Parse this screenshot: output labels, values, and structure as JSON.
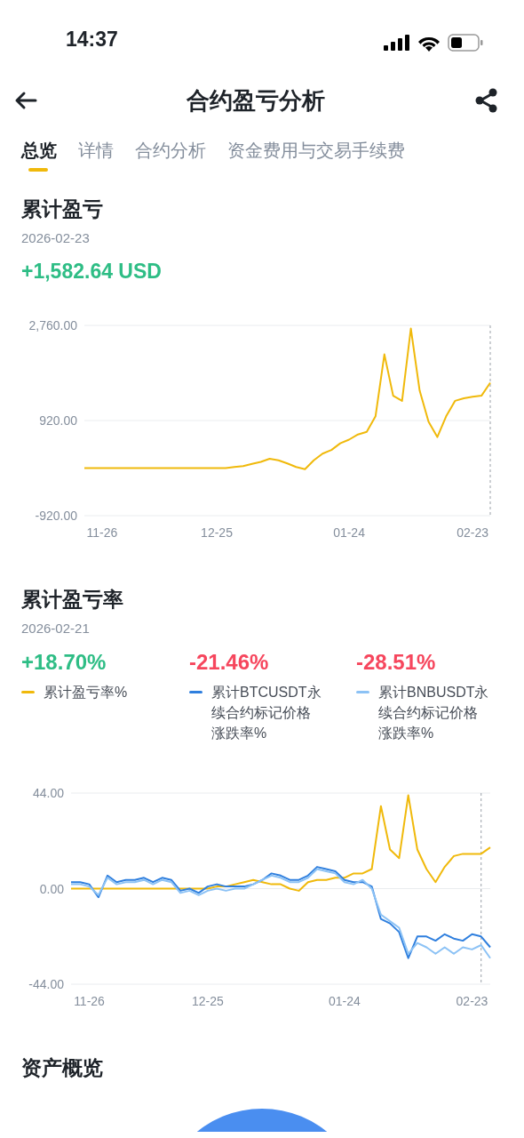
{
  "status_bar": {
    "time": "14:37"
  },
  "header": {
    "title": "合约盈亏分析"
  },
  "tabs": [
    {
      "label": "总览",
      "selected": true
    },
    {
      "label": "详情",
      "selected": false
    },
    {
      "label": "合约分析",
      "selected": false
    },
    {
      "label": "资金费用与交易手续费",
      "selected": false
    }
  ],
  "pnl_section": {
    "title": "累计盈亏",
    "date": "2026-02-23",
    "value": "+1,582.64 USD",
    "color": "#2ebd85",
    "chart_data": {
      "type": "line",
      "categories": [
        null,
        null,
        "11-26",
        null,
        null,
        null,
        null,
        null,
        null,
        null,
        null,
        null,
        null,
        null,
        null,
        "12-25",
        null,
        null,
        null,
        null,
        null,
        null,
        null,
        null,
        null,
        null,
        null,
        null,
        null,
        null,
        "01-24",
        null,
        null,
        null,
        null,
        null,
        null,
        null,
        null,
        null,
        null,
        null,
        null,
        null,
        "02-23",
        null,
        null
      ],
      "series": [
        {
          "color": "#f0b90b",
          "values": [
            0,
            0,
            0,
            0,
            0,
            0,
            0,
            0,
            0,
            0,
            0,
            0,
            0,
            0,
            0,
            0,
            0,
            20,
            40,
            80,
            120,
            180,
            150,
            90,
            20,
            -20,
            150,
            280,
            350,
            480,
            550,
            650,
            700,
            1000,
            2200,
            1400,
            1300,
            2700,
            1500,
            900,
            600,
            1000,
            1300,
            1350,
            1380,
            1400,
            1650
          ]
        }
      ],
      "ylim": [
        -920,
        2760
      ],
      "yticks": [
        {
          "value": -920,
          "label": "-920.00"
        },
        {
          "value": 920,
          "label": "920.00"
        },
        {
          "value": 2760,
          "label": "2,760.00"
        }
      ]
    }
  },
  "rate_section": {
    "title": "累计盈亏率",
    "date": "2026-02-21",
    "stats": [
      {
        "value": "+18.70%",
        "color": "#2ebd85"
      },
      {
        "value": "-21.46%",
        "color": "#f6465d"
      },
      {
        "value": "-28.51%",
        "color": "#f6465d"
      }
    ],
    "chart_data": {
      "type": "line",
      "categories": [
        null,
        null,
        "11-26",
        null,
        null,
        null,
        null,
        null,
        null,
        null,
        null,
        null,
        null,
        null,
        null,
        "12-25",
        null,
        null,
        null,
        null,
        null,
        null,
        null,
        null,
        null,
        null,
        null,
        null,
        null,
        null,
        "01-24",
        null,
        null,
        null,
        null,
        null,
        null,
        null,
        null,
        null,
        null,
        null,
        null,
        null,
        "02-23",
        null,
        null
      ],
      "series": [
        {
          "name": "累计盈亏率%",
          "color": "#f0b90b",
          "values": [
            0,
            0,
            0,
            0,
            0,
            0,
            0,
            0,
            0,
            0,
            0,
            0,
            0,
            0,
            0,
            0,
            1,
            1,
            2,
            3,
            4,
            3,
            2,
            2,
            0,
            -1,
            3,
            4,
            4,
            5,
            5,
            7,
            7,
            9,
            38,
            18,
            14,
            43,
            18,
            9,
            3,
            10,
            15,
            16,
            16,
            16,
            19
          ]
        },
        {
          "name": "累计BTCUSDT永续合约标记价格涨跌率%",
          "color": "#2f7fde",
          "values": [
            3,
            3,
            2,
            -4,
            6,
            3,
            4,
            4,
            5,
            3,
            5,
            4,
            -1,
            0,
            -2,
            1,
            2,
            1,
            1,
            1,
            2,
            4,
            7,
            6,
            4,
            4,
            6,
            10,
            9,
            8,
            4,
            3,
            3,
            1,
            -14,
            -16,
            -20,
            -32,
            -22,
            -22,
            -24,
            -21,
            -23,
            -24,
            -21,
            -22,
            -27
          ]
        },
        {
          "name": "累计BNBUSDT永续合约标记价格涨跌率%",
          "color": "#8cc2f5",
          "values": [
            2,
            2,
            1,
            -3,
            5,
            2,
            3,
            3,
            4,
            2,
            4,
            3,
            -2,
            -1,
            -3,
            -1,
            0,
            -1,
            0,
            0,
            2,
            4,
            6,
            5,
            3,
            3,
            5,
            9,
            8,
            7,
            3,
            2,
            4,
            0,
            -12,
            -15,
            -18,
            -30,
            -25,
            -27,
            -30,
            -27,
            -30,
            -27,
            -28,
            -26,
            -32
          ]
        }
      ],
      "ylim": [
        -44,
        44
      ],
      "yticks": [
        {
          "value": -44,
          "label": "-44.00"
        },
        {
          "value": 0,
          "label": "0.00"
        },
        {
          "value": 44,
          "label": "44.00"
        }
      ]
    }
  },
  "assets_section": {
    "title": "资产概览",
    "kind": "picture"
  }
}
